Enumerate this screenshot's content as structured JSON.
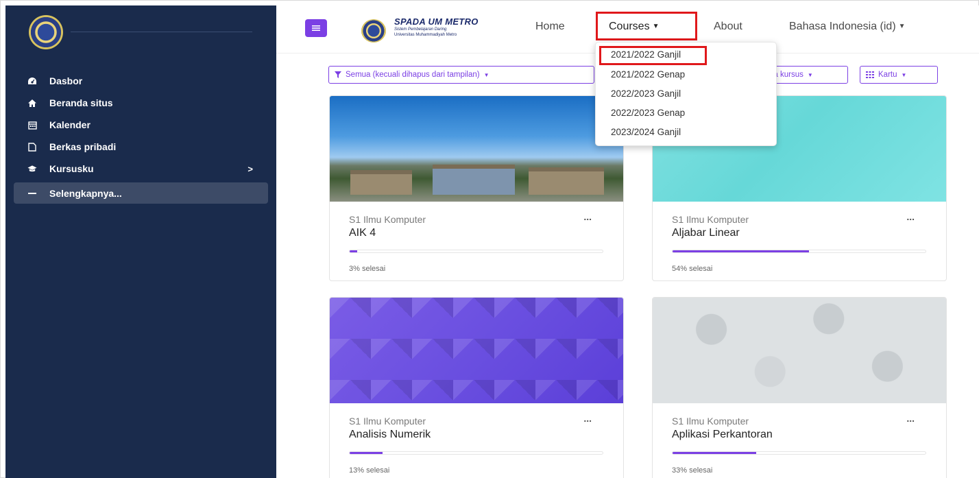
{
  "sidebar": {
    "items": [
      {
        "label": "Dasbor",
        "icon": "dashboard-icon"
      },
      {
        "label": "Beranda situs",
        "icon": "home-icon"
      },
      {
        "label": "Kalender",
        "icon": "calendar-icon"
      },
      {
        "label": "Berkas pribadi",
        "icon": "file-icon"
      },
      {
        "label": "Kursusku",
        "icon": "graduation-cap-icon",
        "chevron": ">"
      },
      {
        "label": "Selengkapnya...",
        "icon": "more-icon",
        "active": true
      }
    ]
  },
  "navbar": {
    "brand_title": "SPADA UM METRO",
    "brand_sub1": "Sistem Pembelajaran Daring",
    "brand_sub2": "Universitas Muhammadiyah Metro",
    "home": "Home",
    "courses": "Courses",
    "about": "About",
    "language": "Bahasa Indonesia (id)",
    "accent_color": "#7b3fe4",
    "highlight_color": "#e0181b"
  },
  "courses_dropdown": {
    "items": [
      "2021/2022 Ganjil",
      "2021/2022 Genap",
      "2022/2023 Ganjil",
      "2022/2023 Genap",
      "2023/2024 Ganjil"
    ]
  },
  "filters": {
    "grouping": "Semua (kecuali dihapus dari tampilan)",
    "sort": "na kursus",
    "view": "Kartu"
  },
  "cards": [
    {
      "category": "S1 Ilmu Komputer",
      "name": "AIK 4",
      "progress": 3,
      "progress_text": "3% selesai"
    },
    {
      "category": "S1 Ilmu Komputer",
      "name": "Aljabar Linear",
      "progress": 54,
      "progress_text": "54% selesai"
    },
    {
      "category": "S1 Ilmu Komputer",
      "name": "Analisis Numerik",
      "progress": 13,
      "progress_text": "13% selesai"
    },
    {
      "category": "S1 Ilmu Komputer",
      "name": "Aplikasi Perkantoran",
      "progress": 33,
      "progress_text": "33% selesai"
    }
  ],
  "card_menu": "..."
}
